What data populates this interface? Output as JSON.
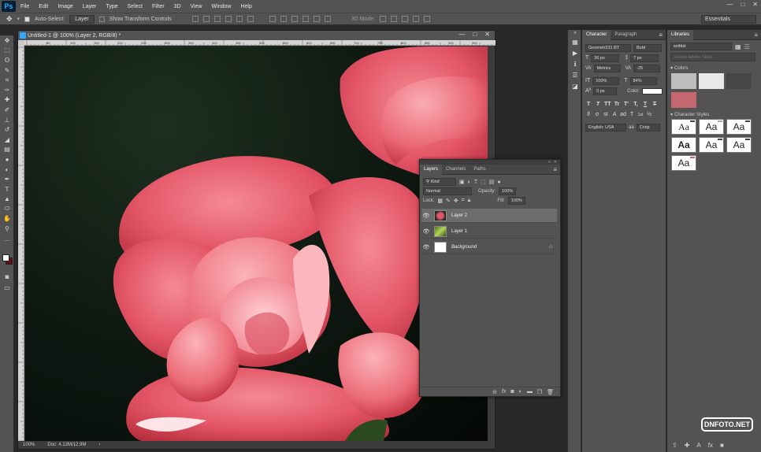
{
  "app": {
    "logo": "Ps"
  },
  "menu": [
    "File",
    "Edit",
    "Image",
    "Layer",
    "Type",
    "Select",
    "Filter",
    "3D",
    "View",
    "Window",
    "Help"
  ],
  "window_controls": [
    "—",
    "□",
    "✕"
  ],
  "options": {
    "auto_select_label": "Auto-Select:",
    "auto_select_value": "Layer",
    "transform_label": "Show Transform Controls",
    "mode_label": "3D Mode:",
    "workspace": "Essentials"
  },
  "document": {
    "title": "Untitled-1 @ 100% (Layer 2, RGB/8) *",
    "zoom": "100%",
    "doc_info": "Doc: 4.12M/12.9M",
    "ruler_ticks": [
      "50",
      "100",
      "150",
      "200",
      "250",
      "300",
      "350",
      "400",
      "450",
      "500",
      "550",
      "600",
      "650",
      "700",
      "750",
      "800",
      "850",
      "900",
      "950"
    ]
  },
  "character": {
    "tabs": [
      "Character",
      "Paragraph"
    ],
    "font_family": "Geometr231 BT",
    "font_style": "Bold",
    "size": "36 px",
    "leading": "7 px",
    "kerning": "Metrics",
    "tracking": "-25",
    "vscale": "100%",
    "hscale": "84%",
    "baseline": "0 px",
    "color_label": "Color:",
    "language": "English: USA",
    "aa": "Crisp",
    "style_glyphs": [
      "T",
      "T",
      "TT",
      "Tr",
      "T'",
      "T,",
      "T",
      "T"
    ],
    "ot_glyphs": [
      "fi",
      "σ",
      "st",
      "A",
      "ad",
      "T",
      "1st",
      "½"
    ]
  },
  "libraries": {
    "title": "Libraries",
    "selected_library": "writtist",
    "search_placeholder": "Search Adobe Stock",
    "colors_label": "Colors",
    "char_styles_label": "Character Styles",
    "colors": [
      "#bebebe",
      "#e8e8e8",
      "#474747",
      "#c4676e"
    ],
    "aa_samples": [
      "Aa",
      "Aa",
      "Aa",
      "Aa",
      "Aa",
      "Aa",
      "Aa"
    ]
  },
  "layers": {
    "tabs": [
      "Layers",
      "Channels",
      "Paths"
    ],
    "filter": "Kind",
    "blend": "Normal",
    "opacity_label": "Opacity:",
    "opacity": "100%",
    "lock_label": "Lock:",
    "fill_label": "Fill:",
    "fill": "100%",
    "items": [
      {
        "name": "Layer 2",
        "selected": true
      },
      {
        "name": "Layer 1",
        "selected": false
      },
      {
        "name": "Background",
        "selected": false,
        "locked": true
      }
    ],
    "footer_icons": [
      "link-icon",
      "fx-icon",
      "mask-icon",
      "adjustment-icon",
      "folder-icon",
      "new-layer-icon",
      "trash-icon"
    ]
  },
  "watermark": "DNFOTO.NET"
}
